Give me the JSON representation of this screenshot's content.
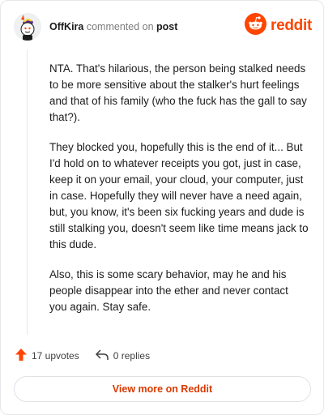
{
  "header": {
    "username": "OffKira",
    "action": "commented on",
    "target": "post",
    "brand": "reddit",
    "avatar_icon": "snoo-avatar-icon",
    "brand_icon": "reddit-logo-icon"
  },
  "comment": {
    "paragraphs": [
      "NTA. That's hilarious, the person being stalked needs to be more sensitive about the stalker's hurt feelings and that of his family (who the fuck has the gall to say that?).",
      "They blocked you, hopefully this is the end of it... But I'd hold on to whatever receipts you got, just in case, keep it on your email, your cloud, your computer, just in case. Hopefully they will never have a need again, but, you know, it's been six fucking years and dude is still stalking you, doesn't seem like time means jack to this dude.",
      "Also, this is some scary behavior, may he and his people disappear into the ether and never contact you again. Stay safe."
    ]
  },
  "actions": {
    "upvotes": "17 upvotes",
    "replies": "0 replies",
    "upvote_icon": "upvote-arrow-icon",
    "reply_icon": "reply-arrow-icon"
  },
  "footer": {
    "button_label": "View more on Reddit"
  },
  "colors": {
    "accent": "#ff4500",
    "button_text": "#d93a00"
  }
}
